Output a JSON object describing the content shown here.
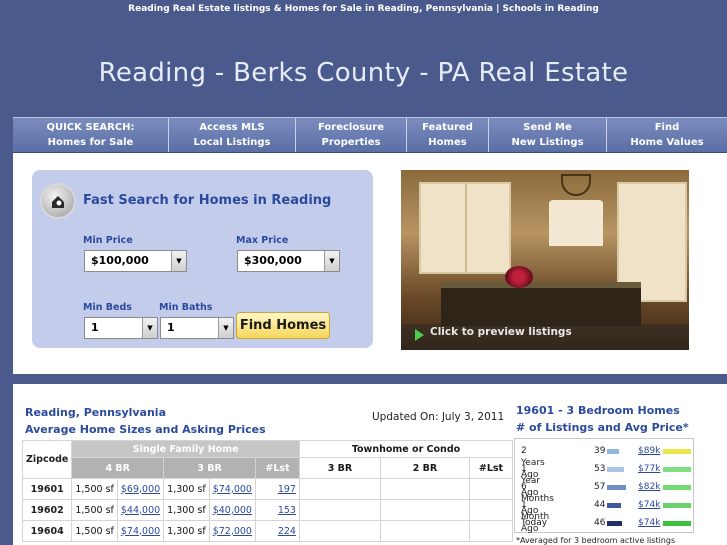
{
  "header": {
    "tagline": "Reading Real Estate listings & Homes for Sale in Reading, Pennsylvania | Schools in Reading",
    "title": "Reading - Berks County - PA Real Estate"
  },
  "nav": [
    {
      "line1": "QUICK SEARCH:",
      "line2": "Homes for Sale"
    },
    {
      "line1": "Access MLS",
      "line2": "Local Listings"
    },
    {
      "line1": "Foreclosure",
      "line2": "Properties"
    },
    {
      "line1": "Featured",
      "line2": "Homes"
    },
    {
      "line1": "Send Me",
      "line2": "New Listings"
    },
    {
      "line1": "Find",
      "line2": "Home Values"
    }
  ],
  "search": {
    "title": "Fast Search for Homes in Reading",
    "min_price_label": "Min Price",
    "min_price_value": "$100,000",
    "max_price_label": "Max Price",
    "max_price_value": "$300,000",
    "min_beds_label": "Min Beds",
    "min_beds_value": "1",
    "min_baths_label": "Min Baths",
    "min_baths_value": "1",
    "button": "Find Homes"
  },
  "photo": {
    "preview_text": "Click to preview listings"
  },
  "summary": {
    "location": "Reading, Pennsylvania",
    "subtitle": "Average Home Sizes and Asking Prices",
    "updated": "Updated On: July 3, 2011",
    "zipcode_header": "Zipcode",
    "single_family_header": "Single Family Home",
    "townhome_header": "Townhome or Condo",
    "sf_cols": [
      "4 BR",
      "3 BR",
      "#Lst"
    ],
    "th_cols": [
      "3 BR",
      "2 BR",
      "#Lst"
    ],
    "rows": [
      {
        "zip": "19601",
        "s4": "1,500 sf",
        "p4": "$69,000",
        "s3": "1,300 sf",
        "p3": "$74,000",
        "lst": "197"
      },
      {
        "zip": "19602",
        "s4": "1,500 sf",
        "p4": "$44,000",
        "s3": "1,300 sf",
        "p3": "$40,000",
        "lst": "153"
      },
      {
        "zip": "19604",
        "s4": "1,500 sf",
        "p4": "$74,000",
        "s3": "1,300 sf",
        "p3": "$72,000",
        "lst": "224"
      }
    ]
  },
  "stats": {
    "title_line1": "19601 - 3 Bedroom Homes",
    "title_line2": "# of Listings and Avg Price*",
    "rows": [
      {
        "period": "2 Years Ago",
        "count": "39",
        "price": "$89k",
        "count_color": "#8fb6d8",
        "price_color": "#e6e64a"
      },
      {
        "period": "1 Year Ago",
        "count": "53",
        "price": "$77k",
        "count_color": "#a9c4e4",
        "price_color": "#7fe07f"
      },
      {
        "period": "6 Months Ago",
        "count": "57",
        "price": "$82k",
        "count_color": "#6f8fc8",
        "price_color": "#74d874"
      },
      {
        "period": "1 Month Ago",
        "count": "44",
        "price": "$74k",
        "count_color": "#3f5aa0",
        "price_color": "#6ad26a"
      },
      {
        "period": "Today",
        "count": "46",
        "price": "$74k",
        "count_color": "#1e2f6e",
        "price_color": "#3fbf3f"
      }
    ],
    "footnote": "*Averaged for 3 bedroom active listings"
  }
}
